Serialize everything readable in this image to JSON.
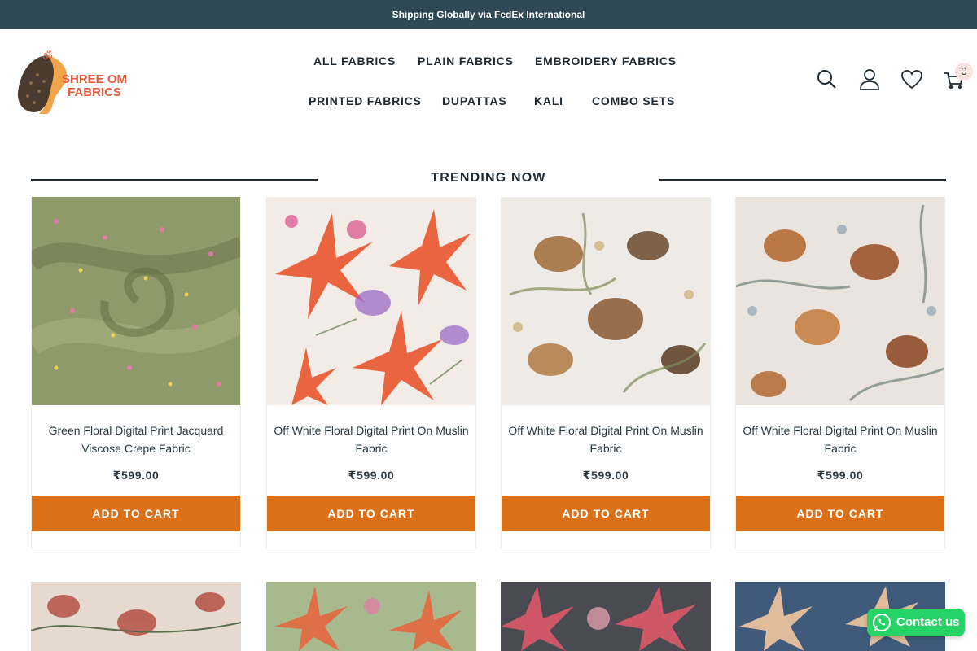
{
  "announcement": "Shipping Globally via FedEx International",
  "brand": {
    "line1": "SHREE OM",
    "line2": "FABRICS"
  },
  "nav": [
    "ALL FABRICS",
    "PLAIN FABRICS",
    "EMBROIDERY FABRICS",
    "PRINTED FABRICS",
    "DUPATTAS",
    "KALI",
    "COMBO SETS"
  ],
  "header_icons": [
    "search-icon",
    "account-icon",
    "wishlist-icon",
    "cart-icon"
  ],
  "cart_count": "0",
  "section": {
    "title": "TRENDING NOW"
  },
  "products": [
    {
      "title": "Green Floral Digital Print Jacquard Viscose Crepe Fabric",
      "price": "₹599.00",
      "button": "ADD TO CART"
    },
    {
      "title": "Off White Floral Digital Print On Muslin Fabric",
      "price": "₹599.00",
      "button": "ADD TO CART"
    },
    {
      "title": "Off White Floral Digital Print On Muslin Fabric",
      "price": "₹599.00",
      "button": "ADD TO CART"
    },
    {
      "title": "Off White Floral Digital Print On Muslin Fabric",
      "price": "₹599.00",
      "button": "ADD TO CART"
    }
  ],
  "whatsapp": {
    "label": "Contact us"
  },
  "colors": {
    "topbar": "#2f4a54",
    "button": "#d9711a",
    "whatsapp": "#25d366",
    "brand": "#e25c3c"
  }
}
